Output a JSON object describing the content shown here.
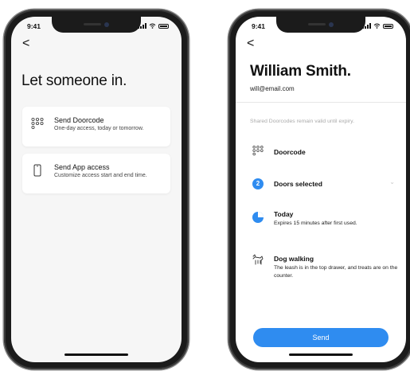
{
  "left_phone": {
    "status": {
      "time": "9:41"
    },
    "back_glyph": "<",
    "title": "Let someone in.",
    "options": [
      {
        "icon": "keypad-icon",
        "title": "Send Doorcode",
        "subtitle": "One-day access, today or tomorrow."
      },
      {
        "icon": "phone-icon",
        "title": "Send App access",
        "subtitle": "Customize access start and end time."
      }
    ]
  },
  "right_phone": {
    "status": {
      "time": "9:41"
    },
    "back_glyph": "<",
    "name": "William Smith.",
    "email": "will@email.com",
    "note": "Shared Doorcodes remain valid until expiry.",
    "doorcode": {
      "icon": "keypad-icon",
      "label": "Doorcode"
    },
    "doors": {
      "count": "2",
      "label": "Doors selected",
      "chevron": "⌄"
    },
    "schedule": {
      "icon": "half-clock-icon",
      "title": "Today",
      "subtitle": "Expires 15 minutes after first used."
    },
    "message": {
      "icon": "dog-icon",
      "title": "Dog walking",
      "body": "The leash is in the top drawer, and treats are on the counter."
    },
    "send_label": "Send"
  },
  "colors": {
    "accent": "#2f8cf0",
    "screen_bg": "#f6f6f6",
    "phone_frame": "#1b1b1b"
  }
}
